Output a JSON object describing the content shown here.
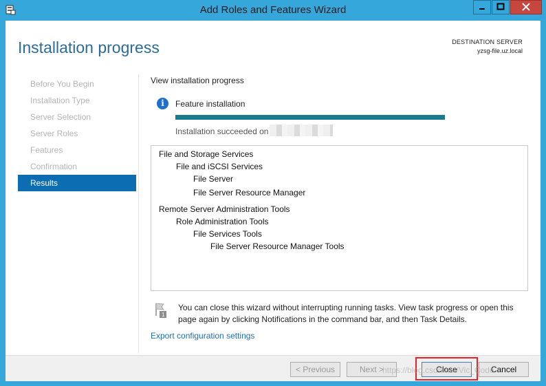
{
  "window": {
    "title": "Add Roles and Features Wizard",
    "icons": {
      "app": "server-manager-icon",
      "minimize": "minimize-icon",
      "maximize": "maximize-icon",
      "close": "close-icon"
    }
  },
  "header": {
    "page_title": "Installation progress",
    "destination_label": "DESTINATION SERVER",
    "destination_value": "yzsg-file.uz.local"
  },
  "nav": {
    "items": [
      {
        "label": "Before You Begin",
        "active": false
      },
      {
        "label": "Installation Type",
        "active": false
      },
      {
        "label": "Server Selection",
        "active": false
      },
      {
        "label": "Server Roles",
        "active": false
      },
      {
        "label": "Features",
        "active": false
      },
      {
        "label": "Confirmation",
        "active": false
      },
      {
        "label": "Results",
        "active": true
      }
    ]
  },
  "main": {
    "section_label": "View installation progress",
    "feature_label": "Feature installation",
    "progress_fraction": 1.0,
    "success_text": "Installation succeeded on",
    "results": [
      {
        "text": "File and Storage Services",
        "level": 0
      },
      {
        "text": "File and iSCSI Services",
        "level": 1
      },
      {
        "text": "File Server",
        "level": 2
      },
      {
        "text": "File Server Resource Manager",
        "level": 2
      },
      {
        "text": "Remote Server Administration Tools",
        "level": 0
      },
      {
        "text": "Role Administration Tools",
        "level": 1
      },
      {
        "text": "File Services Tools",
        "level": 2
      },
      {
        "text": "File Server Resource Manager Tools",
        "level": 3
      }
    ],
    "note_text": "You can close this wizard without interrupting running tasks. View task progress or open this page again by clicking Notifications in the command bar, and then Task Details.",
    "export_link": "Export configuration settings"
  },
  "footer": {
    "previous": "< Previous",
    "next": "Next >",
    "close": "Close",
    "cancel": "Cancel",
    "watermark": "https://blog.csdn.net/Vic_Code"
  },
  "colors": {
    "titlebar": "#35a7db",
    "accent": "#0d6db3",
    "progress": "#1a7a8e",
    "highlight": "#e8222a"
  }
}
